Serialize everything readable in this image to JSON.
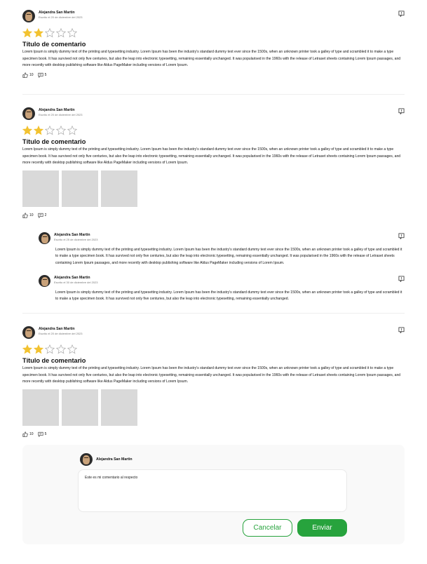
{
  "colors": {
    "star_filled": "#f2c230",
    "star_empty": "#aaaaaa",
    "accent": "#27a33d",
    "image_placeholder": "#d9d9d9"
  },
  "icons": {
    "flag": "report-flag-icon",
    "like": "thumb-up-icon",
    "comment": "comment-icon",
    "avatar": "dog-avatar"
  },
  "reviews": [
    {
      "author": "Alejandra San Martin",
      "date": "Escrito el 20 de diciembre del 2023",
      "rating": 2,
      "max_rating": 5,
      "title": "Título de comentario",
      "body": "Lorem Ipsum is simply dummy text of the printing and typesetting industry. Lorem Ipsum has been the industry's standard dummy text ever since the 1500s, when an unknown printer took a galley of type and scrambled it to make a type specimen book. It has survived not only five centuries, but also the leap into electronic typesetting, remaining essentially unchanged. It was popularised in the 1960s with the release of Letraset sheets containing Lorem Ipsum passages, and more recently with desktop publishing software like Aldus PageMaker including versions of Lorem Ipsum.",
      "likes": "10",
      "comments": "5",
      "images": 0
    },
    {
      "author": "Alejandra San Martin",
      "date": "Escrito el 20 de diciembre del 2023",
      "rating": 2,
      "max_rating": 5,
      "title": "Título de comentario",
      "body": "Lorem Ipsum is simply dummy text of the printing and typesetting industry. Lorem Ipsum has been the industry's standard dummy text ever since the 1500s, when an unknown printer took a galley of type and scrambled it to make a type specimen book. It has survived not only five centuries, but also the leap into electronic typesetting, remaining essentially unchanged. It was popularised in the 1960s with the release of Letraset sheets containing Lorem Ipsum passages, and more recently with desktop publishing software like Aldus PageMaker including versions of Lorem Ipsum.",
      "likes": "10",
      "comments": "2",
      "images": 3
    },
    {
      "author": "Alejandra San Martin",
      "date": "Escrito el 20 de diciembre del 2023",
      "rating": 2,
      "max_rating": 5,
      "title": "Título de comentario",
      "body": "Lorem Ipsum is simply dummy text of the printing and typesetting industry. Lorem Ipsum has been the industry's standard dummy text ever since the 1500s, when an unknown printer took a galley of type and scrambled it to make a type specimen book. It has survived not only five centuries, but also the leap into electronic typesetting, remaining essentially unchanged. It was popularised in the 1960s with the release of Letraset sheets containing Lorem Ipsum passages, and more recently with desktop publishing software like Aldus PageMaker including versions of Lorem Ipsum.",
      "likes": "10",
      "comments": "5",
      "images": 3
    }
  ],
  "replies": [
    {
      "author": "Alejandra San Martin",
      "date": "Escrito el 25 de diciembre del 2023",
      "body": "Lorem Ipsum is simply dummy text of the printing and typesetting industry. Lorem Ipsum has been the industry's standard dummy text ever since the 1500s, when an unknown printer took a galley of type and scrambled it to make a type specimen book. It has survived not only five centuries, but also the leap into electronic typesetting, remaining essentially unchanged. It was popularised in the 1960s with the release of Letraset sheets containing Lorem Ipsum passages, and more recently with desktop publishing software like Aldus PageMaker including versions of Lorem Ipsum."
    },
    {
      "author": "Alejandra San Martin",
      "date": "Escrito el 30 de diciembre del 2023",
      "body": "Lorem Ipsum is simply dummy text of the printing and typesetting industry. Lorem Ipsum has been the industry's standard dummy text ever since the 1500s, when an unknown printer took a galley of type and scrambled it to make a type specimen book. It has survived not only five centuries, but also the leap into electronic typesetting, remaining essentially unchanged."
    }
  ],
  "composer": {
    "author": "Alejandra San Martin",
    "value": "Este es mi comentario al respecto",
    "cancel_label": "Cancelar",
    "send_label": "Enviar"
  }
}
